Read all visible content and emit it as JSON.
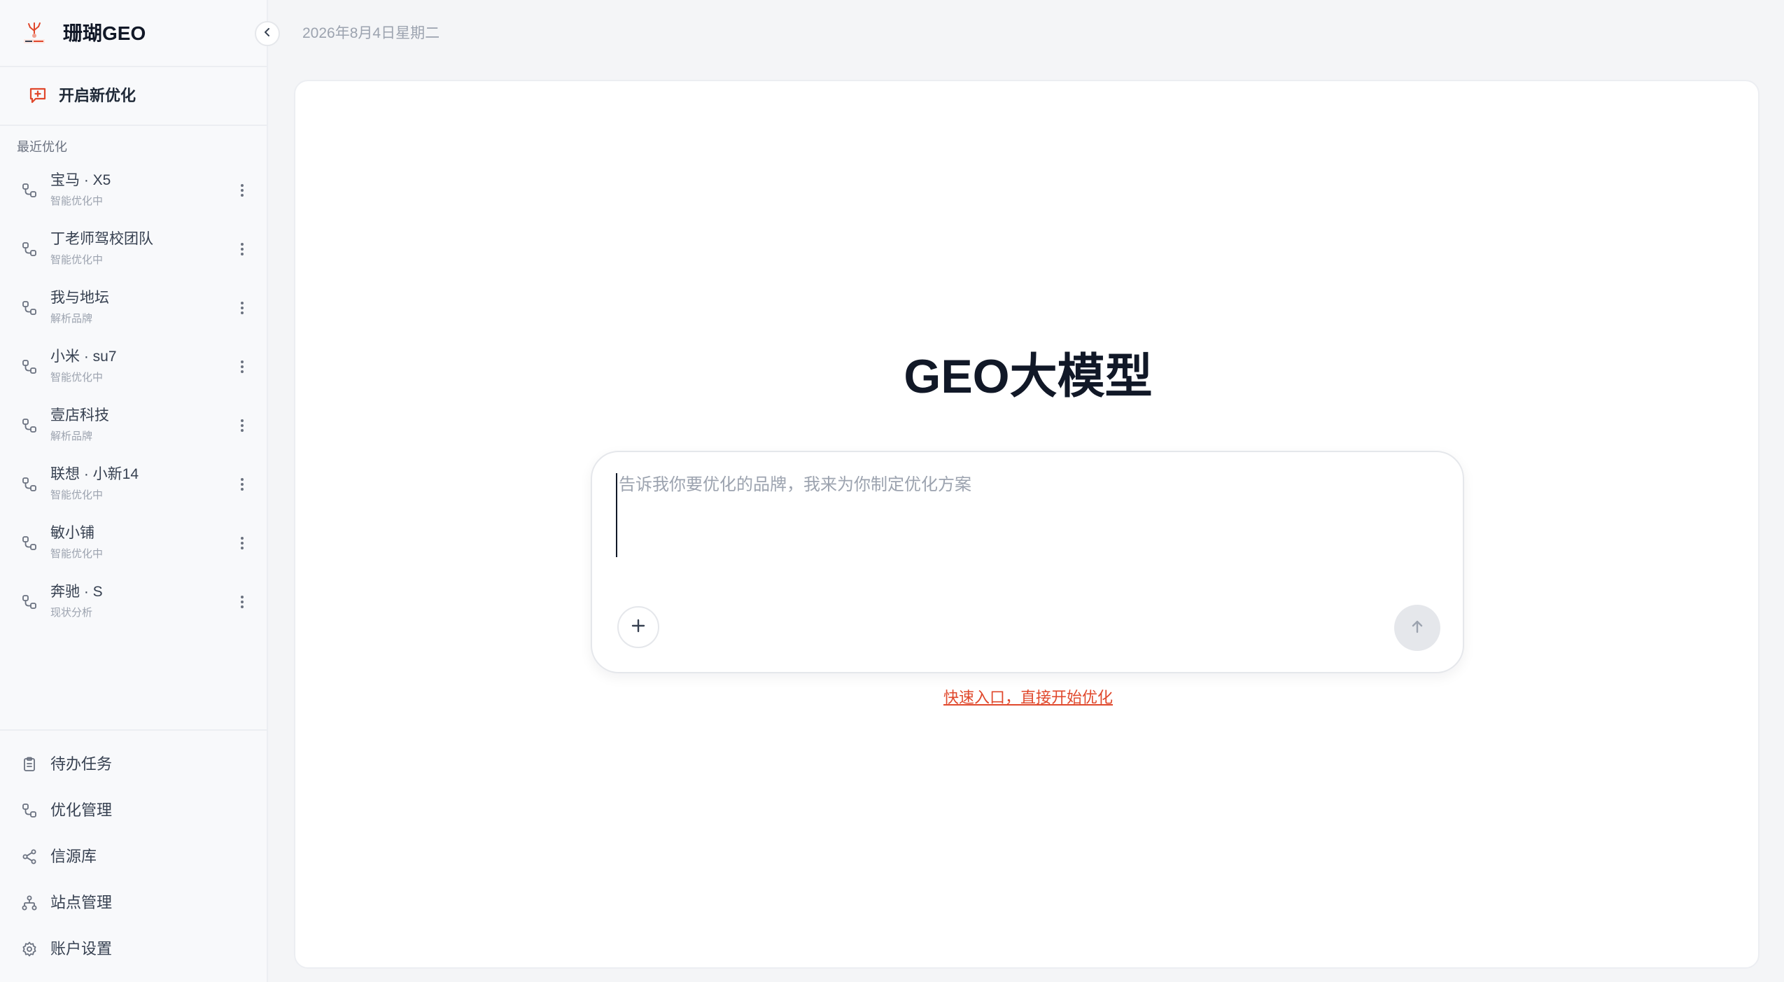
{
  "colors": {
    "accent": "#e0482c",
    "sidebar_bg": "#f8f9fb",
    "page_bg": "#f4f5f7",
    "text_primary": "#111827",
    "text_muted": "#9ca3af"
  },
  "brand": {
    "name": "珊瑚GEO",
    "logo_icon": "coral-logo-icon"
  },
  "sidebar": {
    "collapse_icon": "chevron-left-icon",
    "new_optimization": {
      "label": "开启新优化",
      "icon": "new-chat-icon"
    },
    "recent_title": "最近优化",
    "recent_items": [
      {
        "name": "宝马 · X5",
        "status": "智能优化中"
      },
      {
        "name": "丁老师驾校团队",
        "status": "智能优化中"
      },
      {
        "name": "我与地坛",
        "status": "解析品牌"
      },
      {
        "name": "小米 · su7",
        "status": "智能优化中"
      },
      {
        "name": "壹店科技",
        "status": "解析品牌"
      },
      {
        "name": "联想 · 小新14",
        "status": "智能优化中"
      },
      {
        "name": "敏小铺",
        "status": "智能优化中"
      },
      {
        "name": "奔驰 · S",
        "status": "现状分析"
      }
    ],
    "bottom_items": [
      {
        "label": "待办任务",
        "icon": "clipboard-icon"
      },
      {
        "label": "优化管理",
        "icon": "flow-icon"
      },
      {
        "label": "信源库",
        "icon": "share-icon"
      },
      {
        "label": "站点管理",
        "icon": "sitemap-icon"
      },
      {
        "label": "账户设置",
        "icon": "gear-icon"
      }
    ]
  },
  "header": {
    "date": "2026年8月4日星期二"
  },
  "main": {
    "title": "GEO大模型",
    "input": {
      "placeholder": "告诉我你要优化的品牌，我来为你制定优化方案",
      "value": ""
    },
    "quick_link": "快速入口，直接开始优化"
  }
}
